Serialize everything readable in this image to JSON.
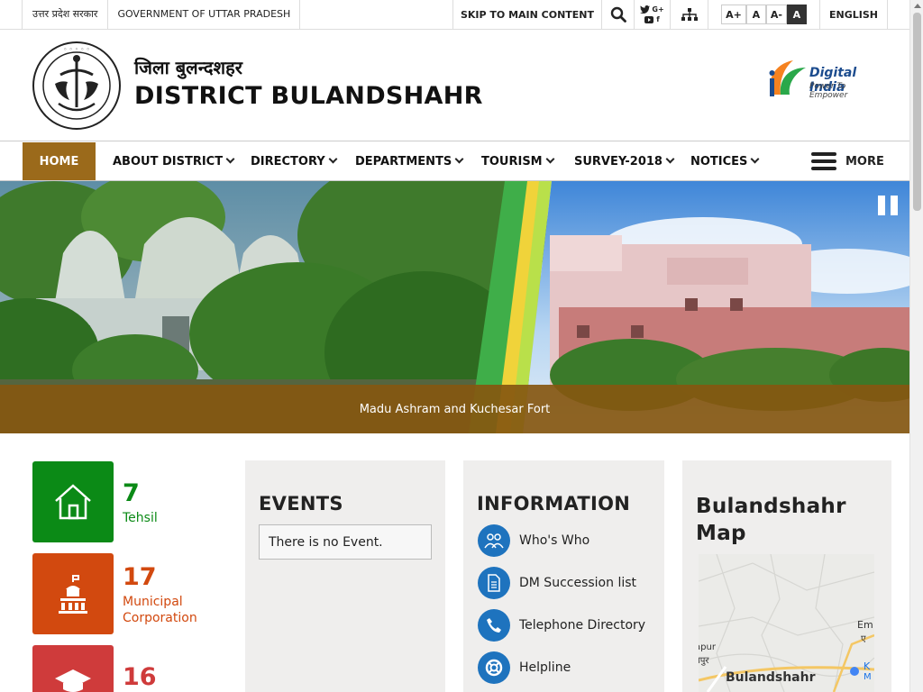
{
  "topbar": {
    "state_hindi": "उत्तर प्रदेश सरकार",
    "state_english": "GOVERNMENT OF UTTAR PRADESH",
    "skip_link": "SKIP TO MAIN CONTENT",
    "social_line1": "G+",
    "social_line2": "f",
    "font_larger": "A+",
    "font_normal": "A",
    "font_smaller": "A-",
    "contrast": "A",
    "language": "ENGLISH"
  },
  "header": {
    "title_hindi": "जिला बुलन्दशहर",
    "title_english": "DISTRICT BULANDSHAHR",
    "digital_india_title": "Digital India",
    "digital_india_tagline": "Power To Empower"
  },
  "nav": {
    "items": [
      {
        "label": "HOME"
      },
      {
        "label": "ABOUT DISTRICT"
      },
      {
        "label": "DIRECTORY"
      },
      {
        "label": "DEPARTMENTS"
      },
      {
        "label": "TOURISM"
      },
      {
        "label": "SURVEY-2018"
      },
      {
        "label": "NOTICES"
      }
    ],
    "more": "MORE"
  },
  "banner": {
    "caption": "Madu Ashram and Kuchesar Fort"
  },
  "stats": [
    {
      "value": "7",
      "label": "Tehsil",
      "color": "#0b8a16"
    },
    {
      "value": "17",
      "label": "Municipal\nCorporation",
      "label_line1": "Municipal",
      "label_line2": "Corporation",
      "color": "#d2490f"
    },
    {
      "value": "16",
      "label": "",
      "color": "#cf3b3b"
    }
  ],
  "events": {
    "heading": "EVENTS",
    "empty_text": "There is no Event."
  },
  "information": {
    "heading": "INFORMATION",
    "items": [
      {
        "label": "Who's Who",
        "icon": "people-icon"
      },
      {
        "label": "DM Succession list",
        "icon": "document-icon"
      },
      {
        "label": "Telephone Directory",
        "icon": "phone-icon"
      },
      {
        "label": "Helpline",
        "icon": "lifebuoy-icon"
      }
    ]
  },
  "map": {
    "heading_line1": "Bulandshahr",
    "heading_line2": "Map",
    "label_city": "Bulandshahr",
    "label_apur": "apur",
    "label_apur_hi": "बपुर",
    "label_em": "Em",
    "label_em_hi": "ए",
    "label_k": "K",
    "label_m": "M"
  },
  "colors": {
    "accent_brown": "#9b6a1b",
    "info_blue": "#1e73be"
  }
}
